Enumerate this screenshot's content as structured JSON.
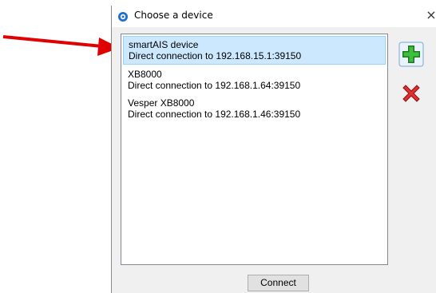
{
  "dialog": {
    "title": "Choose a device",
    "close_label": "×"
  },
  "devices": [
    {
      "name": "smartAIS device",
      "connection": "Direct connection to 192.168.15.1:39150",
      "selected": true
    },
    {
      "name": "XB8000",
      "connection": "Direct connection to 192.168.1.64:39150",
      "selected": false
    },
    {
      "name": "Vesper XB8000",
      "connection": "Direct connection to 192.168.1.46:39150",
      "selected": false
    }
  ],
  "buttons": {
    "add_icon": "plus-icon",
    "remove_icon": "x-icon",
    "connect_label": "Connect"
  },
  "colors": {
    "selection": "#cce8ff",
    "annotation_arrow": "#e00000",
    "add_green": "#2fa82f",
    "remove_red": "#d62020"
  }
}
